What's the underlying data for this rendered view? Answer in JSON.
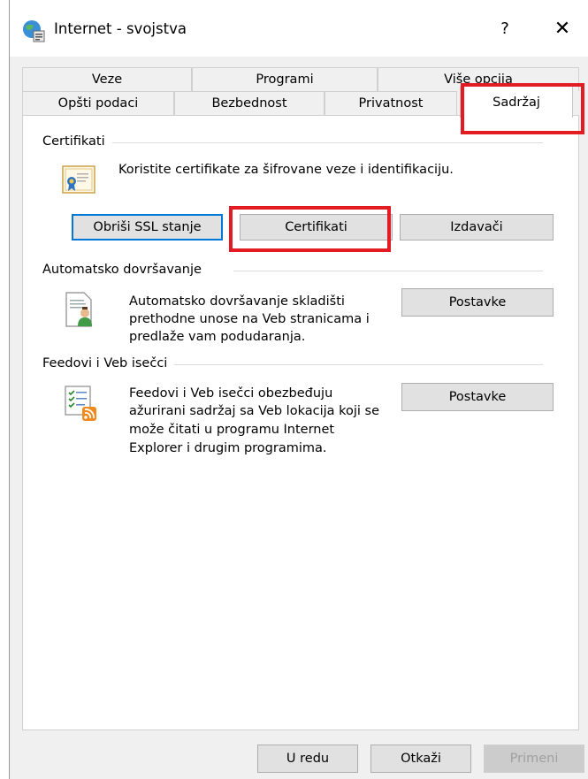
{
  "window": {
    "title": "Internet - svojstva",
    "help_label": "?",
    "close_label": "✕"
  },
  "tabs": {
    "back_row": [
      "Veze",
      "Programi",
      "Više opcija"
    ],
    "front_row": [
      "Opšti podaci",
      "Bezbednost",
      "Privatnost",
      "Sadržaj"
    ],
    "selected": "Sadržaj"
  },
  "certificates": {
    "legend": "Certifikati",
    "description": "Koristite certifikate za šifrovane veze i identifikaciju.",
    "clear_ssl_label": "Obriši SSL stanje",
    "certificates_label": "Certifikati",
    "publishers_label": "Izdavači"
  },
  "autocomplete": {
    "legend": "Automatsko dovršavanje",
    "description_lines": [
      "Automatsko dovršavanje skladišti",
      "prethodne unose na Veb stranicama i",
      "predlaže vam podudaranja."
    ],
    "settings_label": "Postavke"
  },
  "feeds": {
    "legend": "Feedovi i Veb isečci",
    "description_lines": [
      "Feedovi i Veb isečci obezbeđuju",
      "ažurirani sadržaj sa Veb lokacija koji se",
      "može čitati u programu Internet",
      "Explorer i drugim programima."
    ],
    "settings_label": "Postavke"
  },
  "footer": {
    "ok_label": "U redu",
    "cancel_label": "Otkaži",
    "apply_label": "Primeni"
  },
  "colors": {
    "highlight": "#e31b23",
    "focus_border": "#0078d7"
  }
}
